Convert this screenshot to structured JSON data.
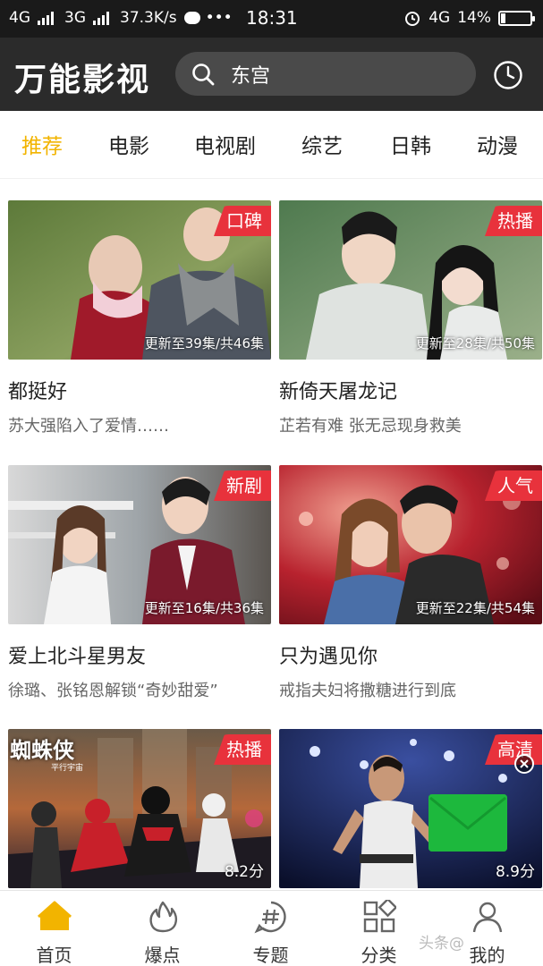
{
  "status_bar": {
    "net1": "4G",
    "net2": "3G",
    "speed": "37.3K/s",
    "dots": "•••",
    "time": "18:31",
    "net3": "4G",
    "battery": "14%"
  },
  "header": {
    "logo": "万能影视",
    "search_value": "东宫"
  },
  "tabs": [
    {
      "label": "推荐",
      "active": true
    },
    {
      "label": "电影"
    },
    {
      "label": "电视剧"
    },
    {
      "label": "综艺"
    },
    {
      "label": "日韩"
    },
    {
      "label": "动漫"
    }
  ],
  "cards": [
    {
      "badge": "口碑",
      "info": "更新至39集/共46集",
      "title": "都挺好",
      "desc": "苏大强陷入了爱情……"
    },
    {
      "badge": "热播",
      "info": "更新至28集/共50集",
      "title": "新倚天屠龙记",
      "desc": "芷若有难 张无忌现身救美"
    },
    {
      "badge": "新剧",
      "info": "更新至16集/共36集",
      "title": "爱上北斗星男友",
      "desc": "徐璐、张铭恩解锁“奇妙甜爱”"
    },
    {
      "badge": "人气",
      "info": "更新至22集/共54集",
      "title": "只为遇见你",
      "desc": "戒指夫妇将撒糖进行到底"
    },
    {
      "badge": "热播",
      "score": "8.2分",
      "poster_text": "蜘蛛侠",
      "poster_sub": "平行宇宙"
    },
    {
      "badge": "高清",
      "score": "8.9分"
    }
  ],
  "bottom_nav": [
    {
      "label": "首页",
      "icon": "home-icon"
    },
    {
      "label": "爆点",
      "icon": "flame-icon"
    },
    {
      "label": "专题",
      "icon": "hashtag-icon"
    },
    {
      "label": "分类",
      "icon": "category-icon"
    },
    {
      "label": "我的",
      "icon": "user-icon"
    }
  ],
  "watermark": "头条@",
  "colors": {
    "accent": "#f2b400",
    "badge": "#e8323c",
    "header": "#2b2b2b"
  }
}
